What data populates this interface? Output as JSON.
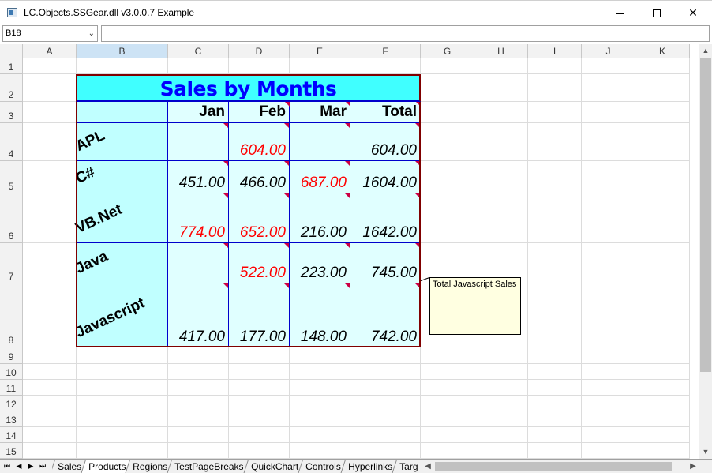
{
  "window": {
    "title": "LC.Objects.SSGear.dll v3.0.0.7 Example"
  },
  "formula_bar": {
    "name_box": "B18",
    "formula": ""
  },
  "columns": [
    "A",
    "B",
    "C",
    "D",
    "E",
    "F",
    "G",
    "H",
    "I",
    "J",
    "K"
  ],
  "rows": [
    "1",
    "2",
    "3",
    "4",
    "5",
    "6",
    "7",
    "8",
    "9",
    "10",
    "11",
    "12",
    "13",
    "14",
    "15"
  ],
  "table": {
    "title": "Sales by Months",
    "headers": [
      "Jan",
      "Feb",
      "Mar",
      "Total"
    ],
    "products": [
      {
        "name": "APL",
        "values": [
          "",
          "604.00",
          "",
          "604.00"
        ]
      },
      {
        "name": "C#",
        "values": [
          "451.00",
          "466.00",
          "687.00",
          "1604.00"
        ]
      },
      {
        "name": "VB.Net",
        "values": [
          "774.00",
          "652.00",
          "216.00",
          "1642.00"
        ]
      },
      {
        "name": "Java",
        "values": [
          "",
          "522.00",
          "223.00",
          "745.00"
        ]
      },
      {
        "name": "Javascript",
        "values": [
          "417.00",
          "177.00",
          "148.00",
          "742.00"
        ]
      }
    ],
    "red_color": "#ff0000",
    "header_color": "#0000ff",
    "title_bg": "#40ffff"
  },
  "comment": {
    "text": "Total Javascript Sales"
  },
  "sheet_tabs": [
    "Sales",
    "Products",
    "Regions",
    "TestPageBreaks",
    "QuickChart",
    "Controls",
    "Hyperlinks",
    "Targ"
  ],
  "active_tab": "Products"
}
